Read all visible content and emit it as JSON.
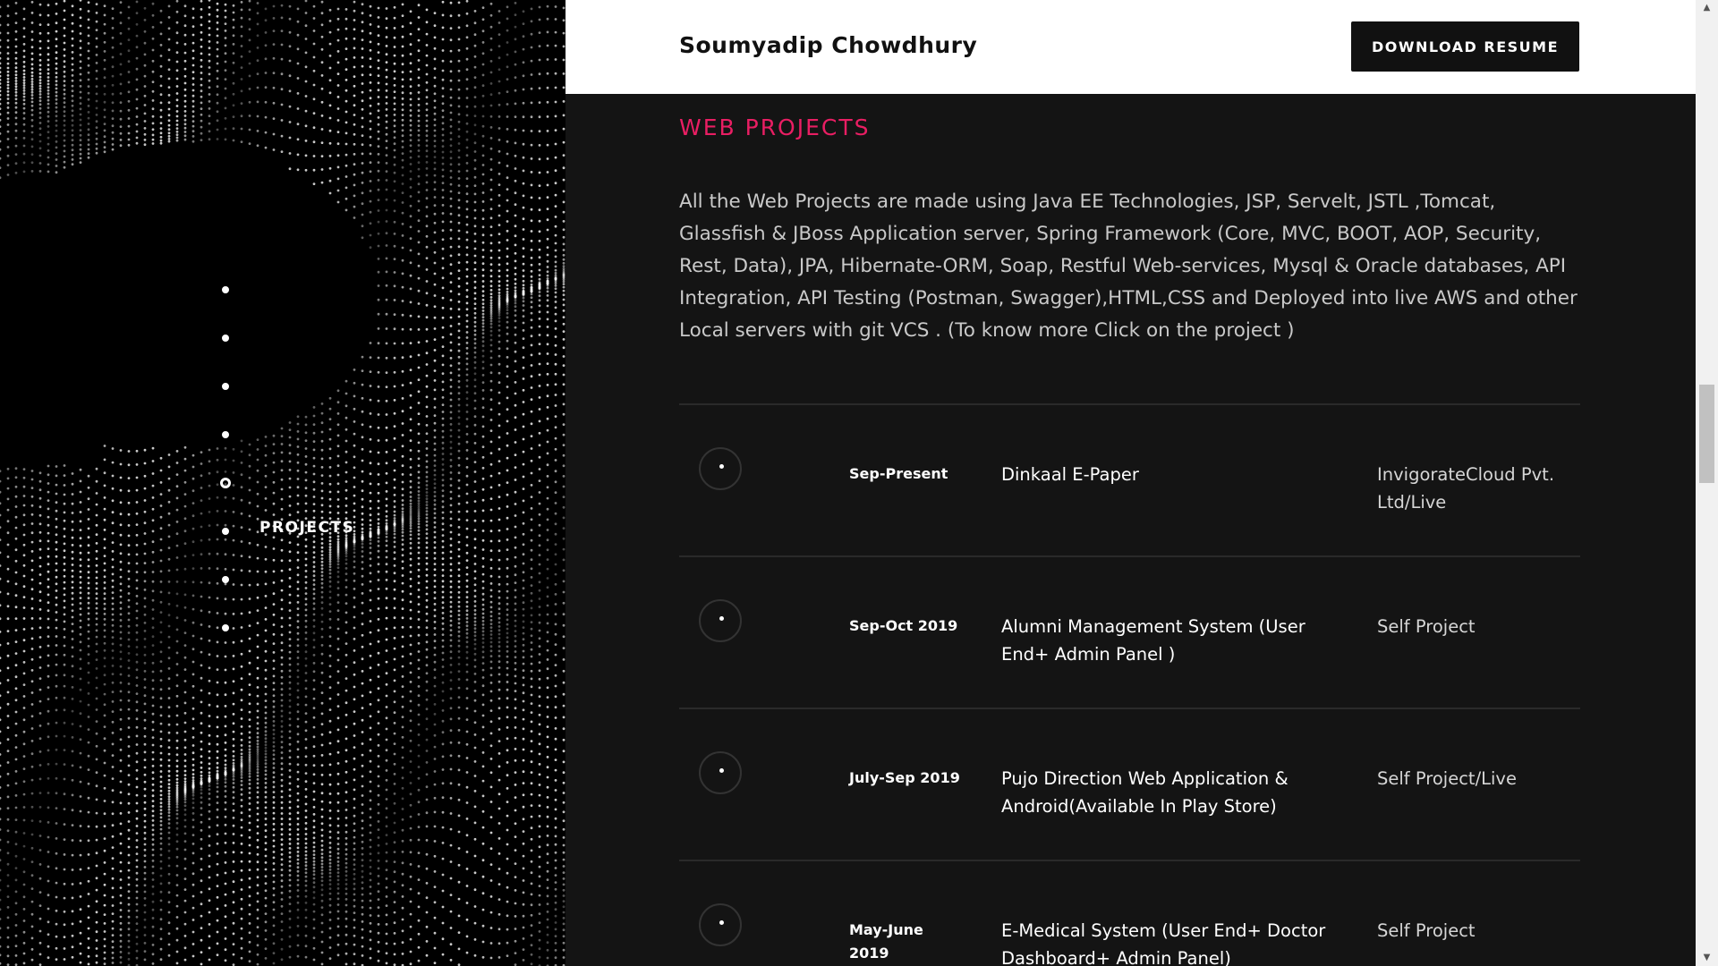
{
  "header": {
    "name": "Soumyadip Chowdhury",
    "download_label": "DOWNLOAD RESUME"
  },
  "nav": {
    "active_label": "PROJECTS",
    "active_index": 4,
    "dot_count": 8
  },
  "section": {
    "title": "WEB PROJECTS",
    "intro": "All the Web Projects are made using Java EE Technologies, JSP, Servelt, JSTL ,Tomcat, Glassfish & JBoss Application server, Spring Framework (Core, MVC, BOOT, AOP, Security, Rest, Data), JPA, Hibernate-ORM, Soap, Restful Web-services, Mysql & Oracle databases, API Integration, API Testing (Postman, Swagger),HTML,CSS and Deployed into live AWS and other Local servers with git VCS . (To know more Click on the project )"
  },
  "projects": [
    {
      "date": "Sep-Present",
      "name": "Dinkaal E-Paper",
      "org": "InvigorateCloud Pvt. Ltd/Live"
    },
    {
      "date": "Sep-Oct 2019",
      "name": "Alumni Management System (User End+ Admin Panel )",
      "org": "Self Project"
    },
    {
      "date": "July-Sep 2019",
      "name": "Pujo Direction Web Application & Android(Available In Play Store)",
      "org": "Self Project/Live"
    },
    {
      "date": "May-June 2019",
      "name": "E-Medical System (User End+ Doctor Dashboard+ Admin Panel)",
      "org": "Self Project"
    }
  ],
  "colors": {
    "accent": "#e91e63",
    "background": "#141414",
    "header_bg": "#ffffff"
  }
}
